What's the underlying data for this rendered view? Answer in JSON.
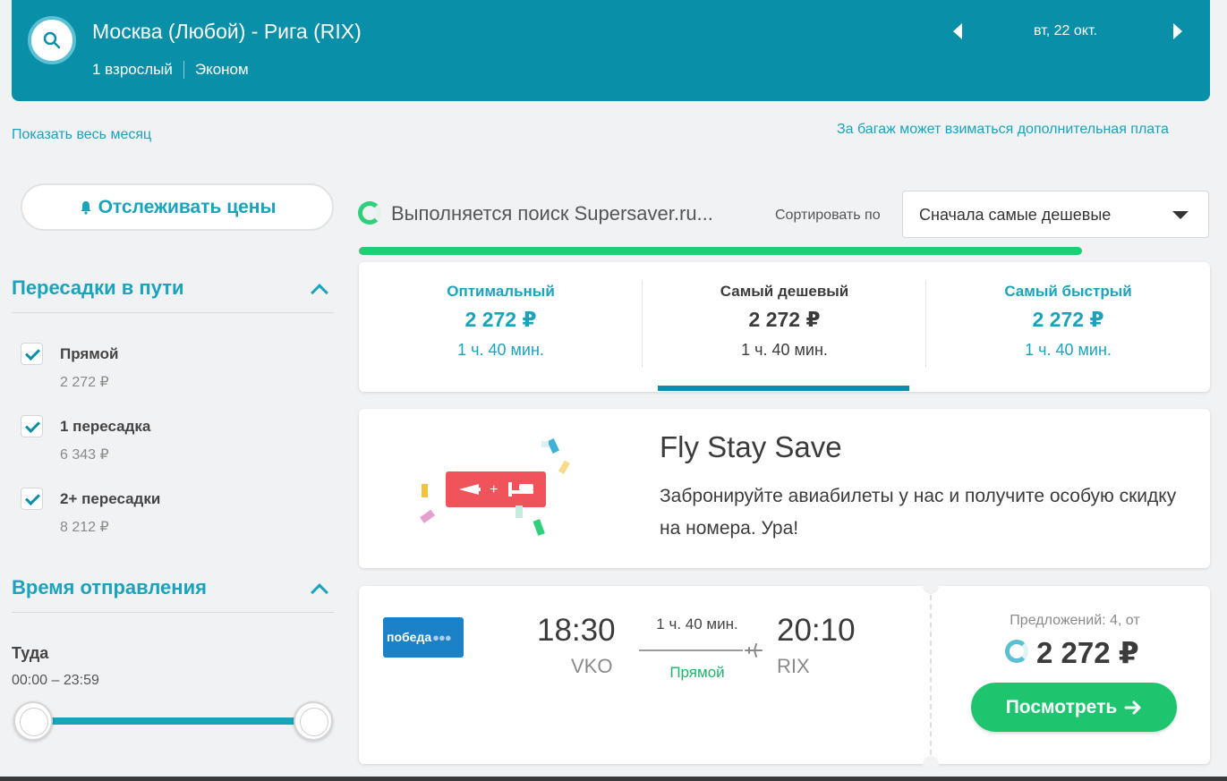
{
  "header": {
    "route": "Москва (Любой) - Рига (RIX)",
    "passengers": "1 взрослый",
    "cabin": "Эконом",
    "date": "вт, 22 окт."
  },
  "links": {
    "show_month": "Показать весь месяц",
    "baggage_notice": "За багаж может взиматься дополнительная плата"
  },
  "sidebar": {
    "track_prices": "Отслеживать цены",
    "stops_title": "Пересадки в пути",
    "stops": [
      {
        "label": "Прямой",
        "price": "2 272 ₽",
        "checked": true
      },
      {
        "label": "1 пересадка",
        "price": "6 343 ₽",
        "checked": true
      },
      {
        "label": "2+ пересадки",
        "price": "8 212 ₽",
        "checked": true
      }
    ],
    "departure_title": "Время отправления",
    "departure_direction": "Туда",
    "departure_range": "00:00 – 23:59"
  },
  "status": {
    "searching": "Выполняется поиск Supersaver.ru...",
    "sort_label": "Сортировать по",
    "sort_value": "Сначала самые дешевые"
  },
  "tabs": [
    {
      "label": "Оптимальный",
      "price": "2 272 ₽",
      "duration": "1 ч. 40 мин."
    },
    {
      "label": "Самый дешевый",
      "price": "2 272 ₽",
      "duration": "1 ч. 40 мин."
    },
    {
      "label": "Самый быстрый",
      "price": "2 272 ₽",
      "duration": "1 ч. 40 мин."
    }
  ],
  "promo": {
    "title": "Fly Stay Save",
    "text": "Забронируйте авиабилеты у нас и получите особую скидку на номера. Ура!"
  },
  "flight": {
    "airline": "победа",
    "depart_time": "18:30",
    "depart_airport": "VKO",
    "arrive_time": "20:10",
    "arrive_airport": "RIX",
    "duration": "1 ч. 40 мин.",
    "stops": "Прямой",
    "offers": "Предложений: 4, от",
    "price": "2 272 ₽",
    "view_button": "Посмотреть"
  },
  "colors": {
    "header_bg": "#0a8fa8",
    "accent": "#1aa3bb",
    "green": "#1fc46f",
    "promo_red": "#f0545a",
    "airline_blue": "#1b82c8"
  }
}
